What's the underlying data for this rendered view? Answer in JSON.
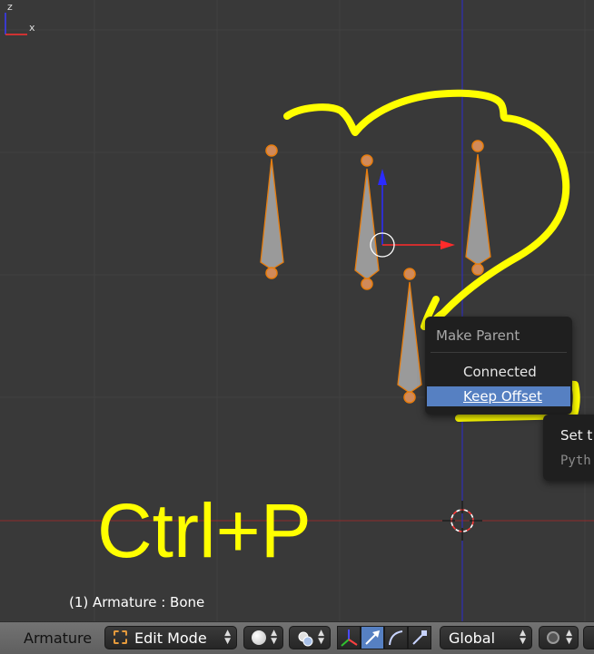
{
  "viewport": {
    "status_text": "(1) Armature : Bone",
    "annotation_text": "Ctrl+P",
    "axis_labels": {
      "x": "x",
      "z": "z"
    },
    "colors": {
      "background": "#393939",
      "annotation": "#ffff00",
      "bone_fill": "#9a9a9a",
      "bone_outline": "#e87d0d",
      "x_axis": "#9a2a2a",
      "z_axis": "#2a2acf"
    }
  },
  "parent_menu": {
    "title": "Make Parent",
    "items": [
      {
        "label": "Connected",
        "highlighted": false
      },
      {
        "label": "Keep Offset",
        "highlighted": true
      }
    ]
  },
  "second_menu": {
    "items": [
      "Set t",
      "Pyth"
    ]
  },
  "header": {
    "editor_label": "Armature",
    "mode": {
      "label": "Edit Mode",
      "icon": "edit-mode-icon"
    },
    "shading_icon": "solid-sphere-icon",
    "pivot_icon": "pivot-point-icon",
    "transform_buttons": [
      {
        "icon": "manipulator-icon",
        "active": false
      },
      {
        "icon": "translate-arrow-icon",
        "active": true
      },
      {
        "icon": "rotate-arc-icon",
        "active": false
      },
      {
        "icon": "scale-icon",
        "active": false
      }
    ],
    "orientation": "Global",
    "snap_icon": "snap-icon"
  }
}
